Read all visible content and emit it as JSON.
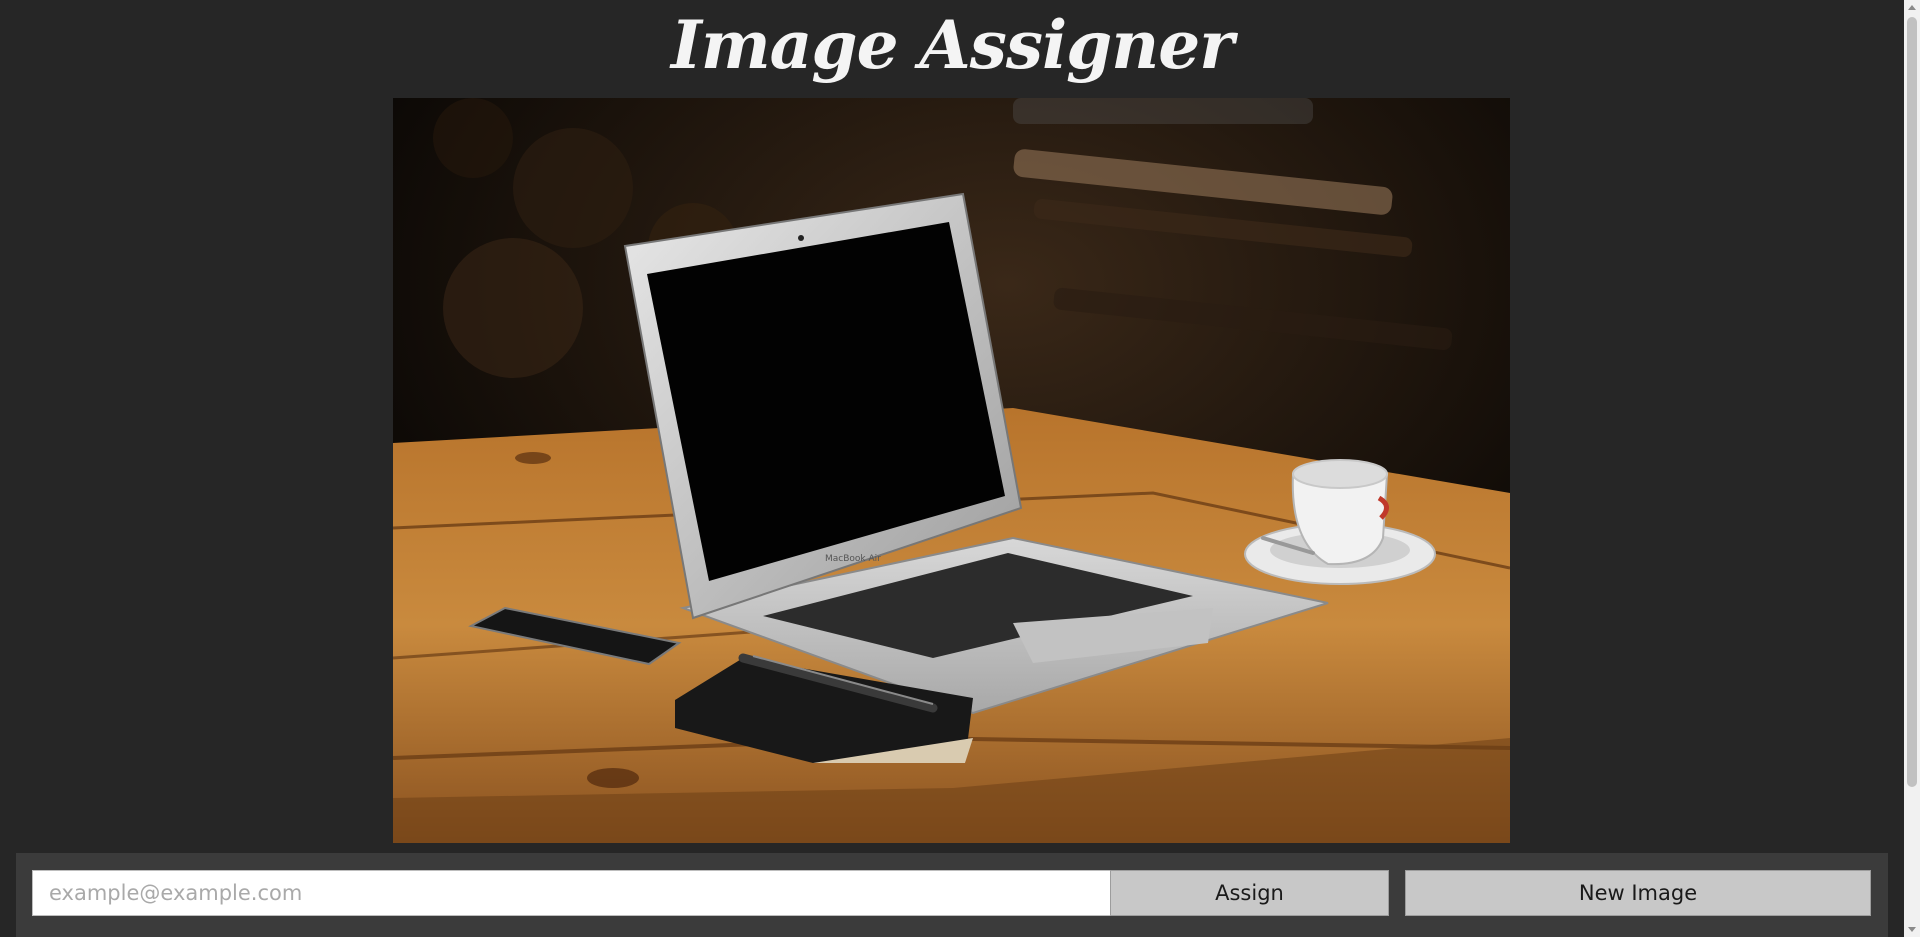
{
  "header": {
    "title": "Image Assigner"
  },
  "photo": {
    "laptop_badge": "MacBook Air"
  },
  "form": {
    "email_placeholder": "example@example.com",
    "email_value": "",
    "assign_label": "Assign",
    "new_image_label": "New Image"
  },
  "colors": {
    "background": "#262626",
    "control_bar": "#3b3b3b",
    "button": "#c8c8c8"
  }
}
